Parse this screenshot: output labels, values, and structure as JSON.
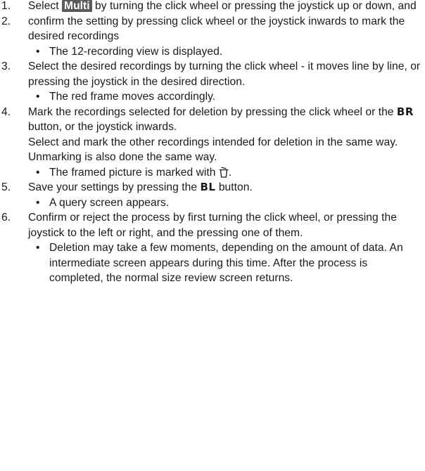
{
  "steps": [
    {
      "number": "1.",
      "before": "Select ",
      "tag": "Multi",
      "after": " by turning the click wheel or pressing the joystick up or down, and"
    },
    {
      "number": "2.",
      "text": "confirm the setting by pressing click wheel or the joystick inwards to mark the desired recordings",
      "subs": [
        "The 12-recording view is displayed."
      ]
    },
    {
      "number": "3.",
      "text": "Select the desired recordings by turning the click wheel - it moves line by line, or pressing the joystick in the desired direction.",
      "subs": [
        "The red frame moves accordingly."
      ]
    },
    {
      "number": "4.",
      "line1_before": "Mark the recordings selected for deletion by pressing the click wheel or the ",
      "line1_button": "BR",
      "line1_after": " button, or the joystick inwards.",
      "line2": "Select and mark the other recordings intended for deletion in the same way.",
      "line3": "Unmarking is also done the same way.",
      "sub_before": "The framed picture is marked with ",
      "sub_after": ".",
      "sub_icon": "trash-icon"
    },
    {
      "number": "5.",
      "before": "Save your settings by pressing the ",
      "button": "BL",
      "after": " button.",
      "subs": [
        "A query screen appears."
      ]
    },
    {
      "number": "6.",
      "text": "Confirm or reject the process by first turning the click wheel, or pressing the joystick to the left or right, and the pressing one of them.",
      "subs": [
        "Deletion may take a few moments, depending on the amount of data. An intermediate screen appears during this time. After the process is completed, the normal size review screen returns."
      ]
    }
  ],
  "bullet_char": "•",
  "colors": {
    "text": "#1a1a1a",
    "tag_background": "#5a5a5a",
    "tag_text": "#ffffff"
  }
}
